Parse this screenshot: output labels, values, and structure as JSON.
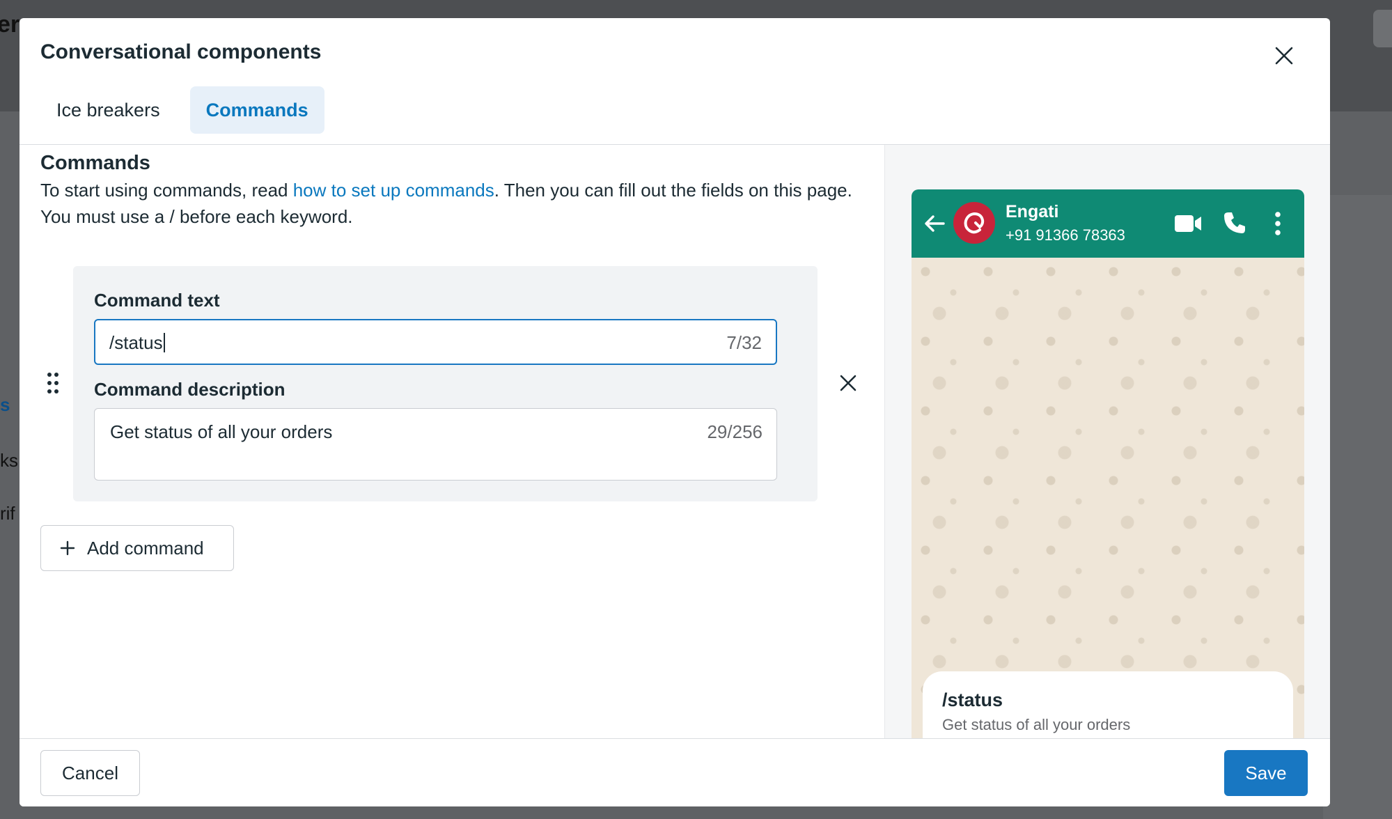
{
  "background": {
    "fragments": [
      "er",
      "s",
      "ks",
      "rif"
    ]
  },
  "modal": {
    "title": "Conversational components",
    "tabs": [
      {
        "label": "Ice breakers",
        "active": false
      },
      {
        "label": "Commands",
        "active": true
      }
    ]
  },
  "commands": {
    "section_title": "Commands",
    "desc_before": "To start using commands, read ",
    "desc_link": "how to set up commands",
    "desc_after": ". Then you can fill out the fields on this page. You must use a / before each keyword.",
    "command_text_label": "Command text",
    "command_text_value": "/status",
    "command_text_counter": "7/32",
    "command_desc_label": "Command description",
    "command_desc_value": "Get status of all your orders",
    "command_desc_counter": "29/256",
    "add_command_label": "Add command"
  },
  "preview": {
    "business_name": "Engati",
    "phone_number": "+91 91366 78363",
    "popup_command": "/status",
    "popup_description": "Get status of all your orders",
    "header_color": "#0f8a74",
    "avatar_color": "#c8243a"
  },
  "footer": {
    "cancel_label": "Cancel",
    "save_label": "Save"
  },
  "colors": {
    "accent": "#1877c2",
    "link": "#0a78be"
  }
}
